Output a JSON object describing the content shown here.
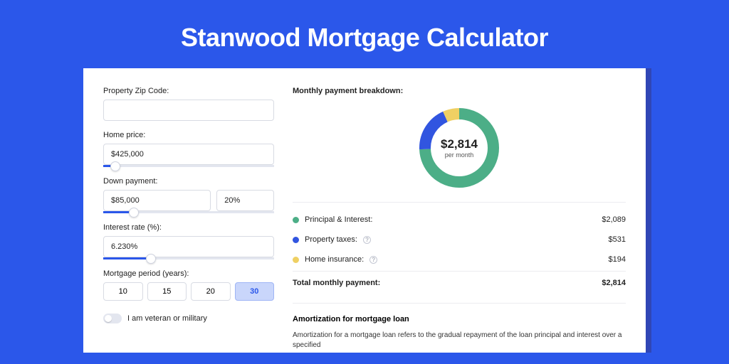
{
  "header": {
    "title": "Stanwood Mortgage Calculator"
  },
  "form": {
    "zip": {
      "label": "Property Zip Code:",
      "value": ""
    },
    "home_price": {
      "label": "Home price:",
      "value": "$425,000",
      "slider_pct": 7
    },
    "down_payment": {
      "label": "Down payment:",
      "amount": "$85,000",
      "pct": "20%",
      "slider_pct": 18
    },
    "interest": {
      "label": "Interest rate (%):",
      "value": "6.230%",
      "slider_pct": 28
    },
    "period": {
      "label": "Mortgage period (years):",
      "options": [
        "10",
        "15",
        "20",
        "30"
      ],
      "active": "30"
    },
    "veteran": {
      "label": "I am veteran or military"
    }
  },
  "breakdown": {
    "title": "Monthly payment breakdown:",
    "total": "$2,814",
    "per_month": "per month",
    "items": [
      {
        "name": "Principal & Interest:",
        "value": "$2,089",
        "color": "green",
        "info": false
      },
      {
        "name": "Property taxes:",
        "value": "$531",
        "color": "blue",
        "info": true
      },
      {
        "name": "Home insurance:",
        "value": "$194",
        "color": "yellow",
        "info": true
      }
    ],
    "total_label": "Total monthly payment:",
    "total_value": "$2,814"
  },
  "chart_data": {
    "type": "pie",
    "title": "Monthly payment breakdown:",
    "series": [
      {
        "name": "Principal & Interest",
        "value": 2089,
        "color": "#4cae87"
      },
      {
        "name": "Property taxes",
        "value": 531,
        "color": "#3155e0"
      },
      {
        "name": "Home insurance",
        "value": 194,
        "color": "#efd063"
      }
    ],
    "total": 2814,
    "center_label": "$2,814",
    "center_sub": "per month"
  },
  "amortization": {
    "title": "Amortization for mortgage loan",
    "text": "Amortization for a mortgage loan refers to the gradual repayment of the loan principal and interest over a specified"
  }
}
